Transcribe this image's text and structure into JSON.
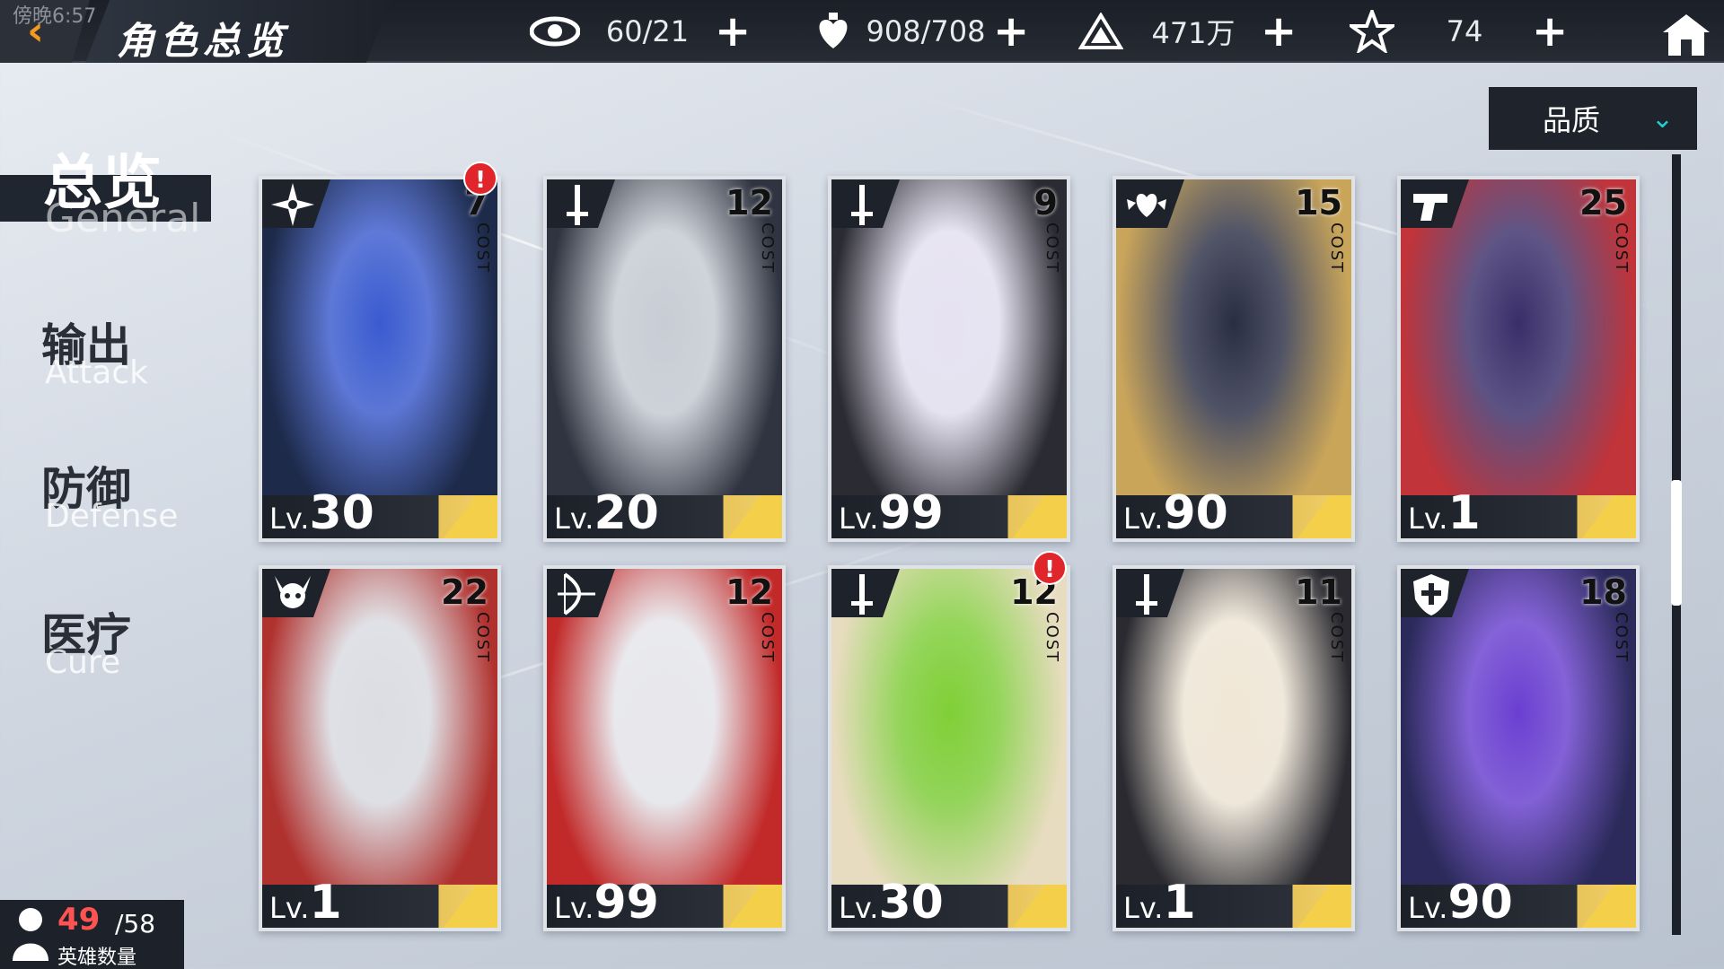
{
  "status_clock": "傍晚6:57",
  "header": {
    "title": "角色总览",
    "resources": [
      {
        "icon": "eye-icon",
        "value": "60/21"
      },
      {
        "icon": "heart-potion-icon",
        "value": "908/708"
      },
      {
        "icon": "pyramid-icon",
        "value": "471万"
      },
      {
        "icon": "star-icon",
        "value": "74"
      }
    ]
  },
  "sort": {
    "label": "品质"
  },
  "nav": [
    {
      "label": "总览",
      "sub": "General",
      "active": true
    },
    {
      "label": "输出",
      "sub": "Attack",
      "active": false
    },
    {
      "label": "防御",
      "sub": "Defense",
      "active": false
    },
    {
      "label": "医疗",
      "sub": "Cure",
      "active": false
    }
  ],
  "cost_label": "COST",
  "lv_prefix": "Lv.",
  "heroes": [
    {
      "cost": "7",
      "level": "30",
      "class_icon": "shuriken-icon",
      "alert": true,
      "palette": [
        "#3a5bd0",
        "#1d2a4a"
      ]
    },
    {
      "cost": "12",
      "level": "20",
      "class_icon": "sword-icon",
      "alert": false,
      "palette": [
        "#c8ccd4",
        "#2f3440"
      ]
    },
    {
      "cost": "9",
      "level": "99",
      "class_icon": "sword-icon",
      "alert": false,
      "palette": [
        "#e6e2f2",
        "#2b2b33"
      ]
    },
    {
      "cost": "15",
      "level": "90",
      "class_icon": "heart-wings-icon",
      "alert": false,
      "palette": [
        "#2a2e44",
        "#c9a55a"
      ]
    },
    {
      "cost": "25",
      "level": "1",
      "class_icon": "pistol-icon",
      "alert": false,
      "palette": [
        "#3a2e6a",
        "#c0343a"
      ]
    },
    {
      "cost": "22",
      "level": "1",
      "class_icon": "horned-skull-icon",
      "alert": false,
      "palette": [
        "#dcdde2",
        "#b0322f"
      ]
    },
    {
      "cost": "12",
      "level": "99",
      "class_icon": "bow-icon",
      "alert": false,
      "palette": [
        "#e8e8ec",
        "#c22a2a"
      ]
    },
    {
      "cost": "12",
      "level": "30",
      "class_icon": "sword-icon",
      "alert": true,
      "palette": [
        "#7fcf36",
        "#e8dcc0"
      ]
    },
    {
      "cost": "11",
      "level": "1",
      "class_icon": "sword-icon",
      "alert": false,
      "palette": [
        "#f1e7d6",
        "#2a2a30"
      ]
    },
    {
      "cost": "18",
      "level": "90",
      "class_icon": "shield-cross-icon",
      "alert": false,
      "palette": [
        "#6a3fd1",
        "#2b2a5a"
      ]
    }
  ],
  "hero_count": {
    "current": "49",
    "total": "/58",
    "label": "英雄数量"
  },
  "colors": {
    "accent_orange": "#f29a1f",
    "accent_teal": "#1fd1d0",
    "alert_red": "#e0262a",
    "level_gold": "#f4cf4a"
  }
}
